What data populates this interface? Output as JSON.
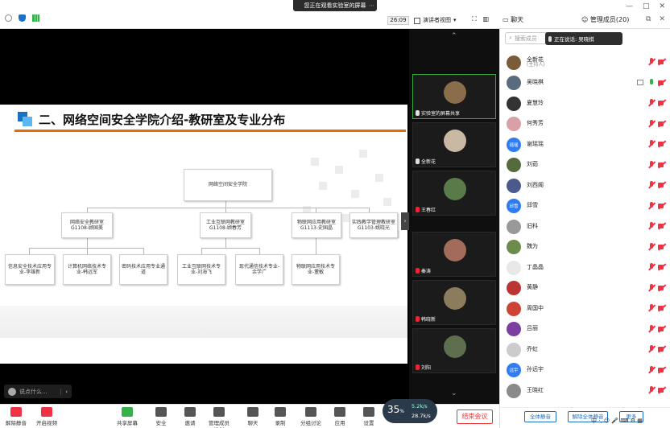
{
  "banner": "您正在观看实验室的屏幕",
  "timer": "26:09",
  "view_mode": "演讲者视图",
  "right_tabs": {
    "chat": "聊天",
    "manage": "管理成员(20)"
  },
  "slide": {
    "title": "二、网络空间安全学院介绍-教研室及专业分布",
    "root": "网络空间安全学院",
    "level1": [
      "网络安全教研室G1108-顾国美",
      "工业互联网教研室G1108-顾春芳",
      "物联网应用教研室G1113-史国晶",
      "实践教学管理教研室G1103-姚晓光"
    ],
    "level2": [
      "信息安全技术应用专业-李雄新",
      "计算机网络技术专业-韩远军",
      "密码技术应用专业通道",
      "工业互联网技术专业-刘海飞",
      "现代通信技术专业-余学广",
      "物联网应用技术专业-董敏"
    ]
  },
  "speak_input": "说点什么...",
  "video_tiles": [
    {
      "name": "实验室的屏幕共享",
      "mic": "on"
    },
    {
      "name": "全新花",
      "mic": "on"
    },
    {
      "name": "王春红",
      "mic": "off"
    },
    {
      "name": "秦涛",
      "mic": "off"
    },
    {
      "name": "韩晓新",
      "mic": "off"
    },
    {
      "name": "刘阳",
      "mic": "off"
    }
  ],
  "search_placeholder": "搜索成员",
  "speaking_label": "正在说话: 吴晓棋",
  "participants": [
    {
      "name": "全新花",
      "sub": "(主持人)",
      "mic": "off",
      "screen": false,
      "avatar_color": "#7a5c3a",
      "avatar_text": ""
    },
    {
      "name": "吴晓棋",
      "sub": "",
      "mic": "on",
      "screen": true,
      "avatar_color": "#5b6b7e",
      "avatar_text": ""
    },
    {
      "name": "夏慧玲",
      "sub": "",
      "mic": "off",
      "screen": false,
      "avatar_color": "#333",
      "avatar_text": ""
    },
    {
      "name": "何秀芳",
      "sub": "",
      "mic": "off",
      "screen": false,
      "avatar_color": "#d9a0a8",
      "avatar_text": ""
    },
    {
      "name": "谢瑶瑶",
      "sub": "",
      "mic": "off",
      "screen": false,
      "avatar_color": "#2f7bf2",
      "avatar_text": "瑶瑶"
    },
    {
      "name": "刘茹",
      "sub": "",
      "mic": "off",
      "screen": false,
      "avatar_color": "#556a3d",
      "avatar_text": ""
    },
    {
      "name": "刘西阁",
      "sub": "",
      "mic": "off",
      "screen": false,
      "avatar_color": "#4b5a8a",
      "avatar_text": ""
    },
    {
      "name": "邱雪",
      "sub": "",
      "mic": "off",
      "screen": false,
      "avatar_color": "#2f7bf2",
      "avatar_text": "邱雪"
    },
    {
      "name": "旧科",
      "sub": "",
      "mic": "off",
      "screen": false,
      "avatar_color": "#999",
      "avatar_text": ""
    },
    {
      "name": "魏为",
      "sub": "",
      "mic": "off",
      "screen": false,
      "avatar_color": "#6d8b4a",
      "avatar_text": ""
    },
    {
      "name": "丁晶晶",
      "sub": "",
      "mic": "off",
      "screen": false,
      "avatar_color": "#e8e8e8",
      "avatar_text": ""
    },
    {
      "name": "黄静",
      "sub": "",
      "mic": "off",
      "screen": false,
      "avatar_color": "#b33",
      "avatar_text": ""
    },
    {
      "name": "周国中",
      "sub": "",
      "mic": "off",
      "screen": false,
      "avatar_color": "#c43",
      "avatar_text": ""
    },
    {
      "name": "吕丽",
      "sub": "",
      "mic": "off",
      "screen": false,
      "avatar_color": "#7a3fa0",
      "avatar_text": ""
    },
    {
      "name": "乔虹",
      "sub": "",
      "mic": "off",
      "screen": false,
      "avatar_color": "#ccc",
      "avatar_text": ""
    },
    {
      "name": "孙远宇",
      "sub": "",
      "mic": "off",
      "screen": false,
      "avatar_color": "#2f7bf2",
      "avatar_text": "远宇"
    },
    {
      "name": "王晓红",
      "sub": "",
      "mic": "off",
      "screen": false,
      "avatar_color": "#8a8a8a",
      "avatar_text": ""
    }
  ],
  "footer_buttons": {
    "mute_all": "全体静音",
    "unmute_all": "解除全体静音",
    "more": "更多"
  },
  "toolbar": [
    {
      "label": "解除静音",
      "color": "#e34"
    },
    {
      "label": "开启视频",
      "color": "#e34"
    },
    {
      "label": "共享屏幕",
      "color": "#35b24a"
    },
    {
      "label": "安全",
      "color": "#555"
    },
    {
      "label": "邀请",
      "color": "#555"
    },
    {
      "label": "管理成员(20)",
      "color": "#555"
    },
    {
      "label": "聊天",
      "color": "#555"
    },
    {
      "label": "录制",
      "color": "#555"
    },
    {
      "label": "分组讨论",
      "color": "#555"
    },
    {
      "label": "应用",
      "color": "#555"
    },
    {
      "label": "设置",
      "color": "#555"
    }
  ],
  "net": {
    "value": "35",
    "unit": "%",
    "up": "5.2k/s",
    "down": "28.7k/s"
  },
  "end_button": "结束会议",
  "tray": "中 ·, ☺ 🎤 ⌨ ⚙ ▦"
}
